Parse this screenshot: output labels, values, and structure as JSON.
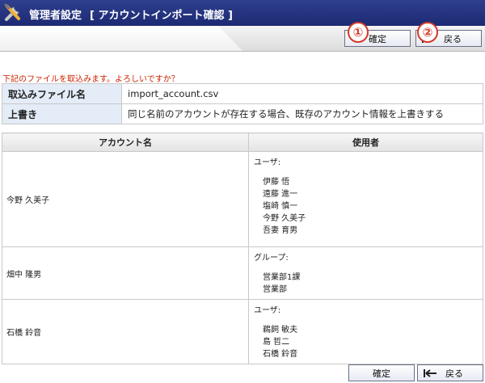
{
  "header": {
    "title": "管理者設定",
    "subtitle": "[ アカウントインポート確認 ]"
  },
  "toolbar": {
    "confirm_label": "確定",
    "back_label": "戻る",
    "badge1": "①",
    "badge2": "②"
  },
  "notice": "下記のファイルを取込みます。よろしいですか？",
  "info": {
    "file_label": "取込みファイル名",
    "file_value": "import_account.csv",
    "overwrite_label": "上書き",
    "overwrite_value": "同じ名前のアカウントが存在する場合、既存のアカウント情報を上書きする"
  },
  "list": {
    "headers": [
      "アカウント名",
      "使用者"
    ],
    "rows": [
      {
        "account": "今野 久美子",
        "group_label": "ユーザ:",
        "members": [
          "伊藤 悟",
          "遠藤 進一",
          "塩崎 慎一",
          "今野 久美子",
          "吾妻 育男"
        ]
      },
      {
        "account": "畑中 隆男",
        "group_label": "グループ:",
        "members": [
          "営業部1課",
          "営業部"
        ]
      },
      {
        "account": "石橋 鈴音",
        "group_label": "ユーザ:",
        "members": [
          "鵜飼 敏夫",
          "島 哲二",
          "石橋 鈴音"
        ]
      }
    ]
  },
  "colors": {
    "title_bar": "#1d2a73",
    "notice": "#cc2200",
    "label_cell": "#e3ecf7",
    "badge": "#d23a2a"
  },
  "icons": {
    "title": "tools-icon",
    "back": "back-arrow-icon"
  }
}
